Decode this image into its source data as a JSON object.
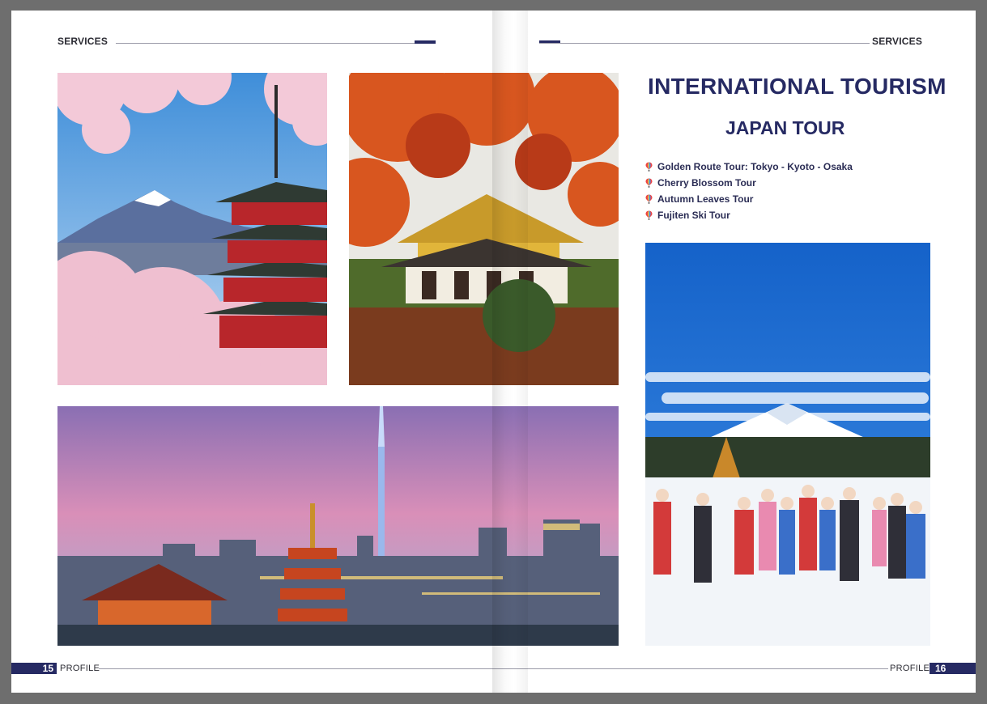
{
  "header": {
    "left_section": "SERVICES",
    "right_section": "SERVICES"
  },
  "content": {
    "title": "INTERNATIONAL TOURISM",
    "subtitle": "JAPAN TOUR",
    "tours": [
      {
        "label": "Golden Route Tour: Tokyo - Kyoto - Osaka",
        "icon": "balloon-pin-icon"
      },
      {
        "label": "Cherry Blossom Tour",
        "icon": "balloon-pin-icon"
      },
      {
        "label": "Autumn Leaves Tour",
        "icon": "balloon-pin-icon"
      },
      {
        "label": "Fujiten Ski Tour",
        "icon": "balloon-pin-icon"
      }
    ]
  },
  "photos": [
    {
      "subject": "Chureito pagoda with Mount Fuji and cherry blossoms"
    },
    {
      "subject": "Golden pavilion with autumn maple leaves"
    },
    {
      "subject": "Tokyo skyline at dusk with Sensoji temple and Skytree"
    },
    {
      "subject": "Ski tour group in the snow with Mount Fuji behind"
    }
  ],
  "footer": {
    "left_page_number": "15",
    "left_label": "PROFILE",
    "right_label": "PROFILE",
    "right_page_number": "16"
  },
  "colors": {
    "accent": "#262a63",
    "rule": "#9a9aa8",
    "background": "#6e6e6e"
  }
}
